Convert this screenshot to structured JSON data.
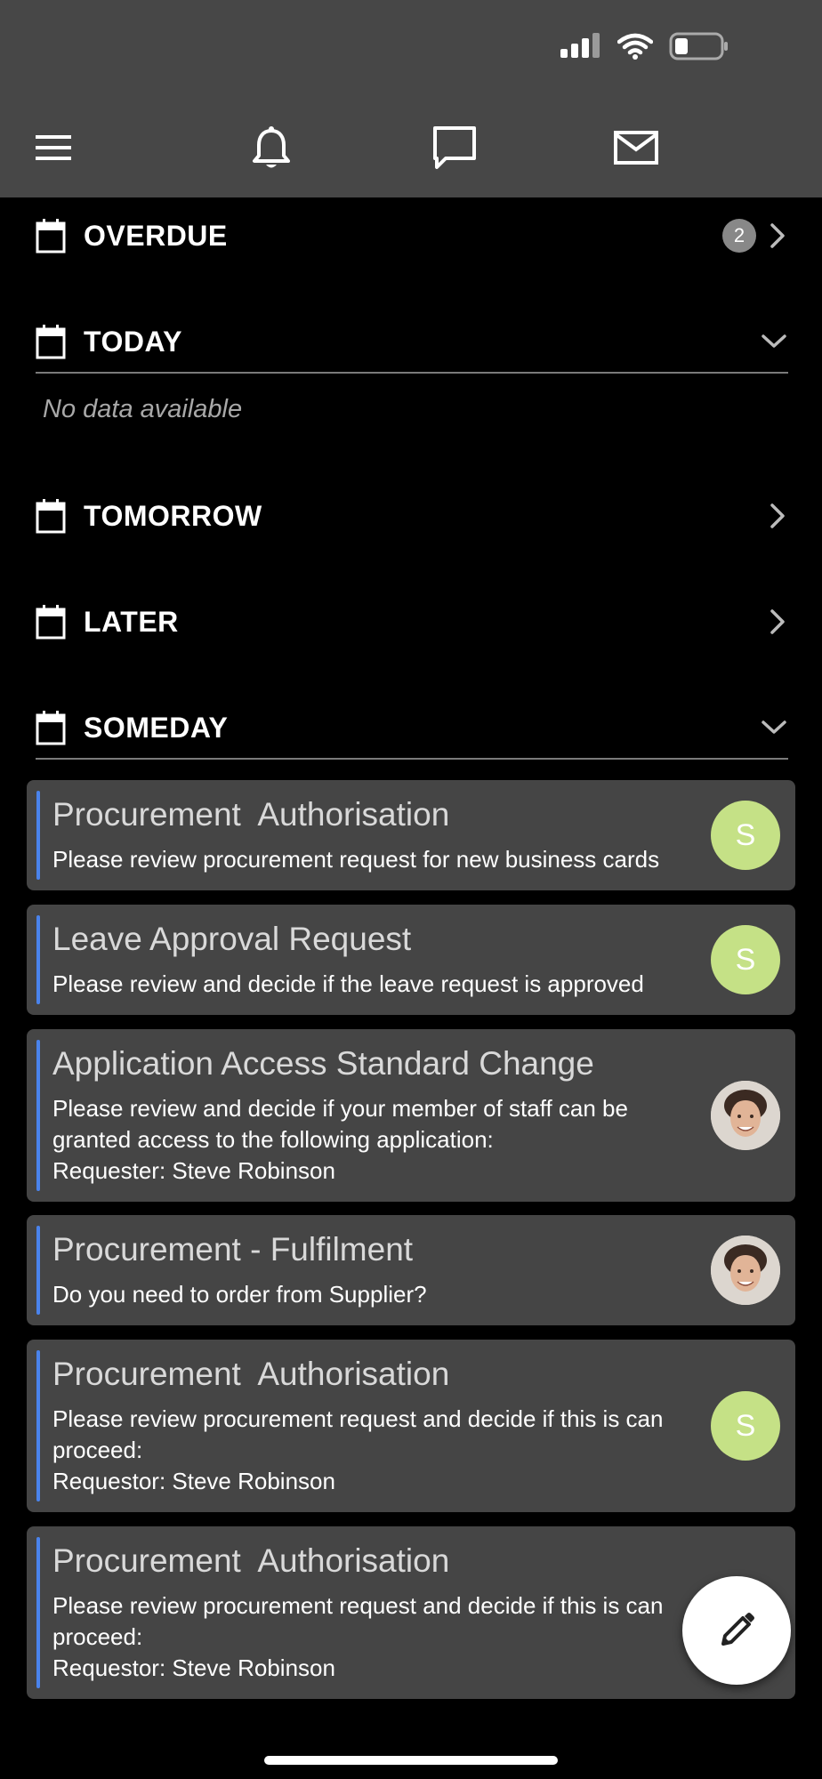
{
  "nav": {
    "icons": [
      "menu-icon",
      "bell-icon",
      "chat-icon",
      "mail-icon"
    ]
  },
  "sections": {
    "overdue": {
      "label": "OVERDUE",
      "count": "2"
    },
    "today": {
      "label": "TODAY",
      "empty_text": "No data available"
    },
    "tomorrow": {
      "label": "TOMORROW"
    },
    "later": {
      "label": "LATER"
    },
    "someday": {
      "label": "SOMEDAY"
    }
  },
  "tasks": [
    {
      "title": "Procurement  Authorisation",
      "description": "Please review procurement request for new business cards",
      "avatar_letter": "S"
    },
    {
      "title": "Leave Approval Request",
      "description": "Please review and decide if the leave request is approved",
      "avatar_letter": "S"
    },
    {
      "title": "Application Access Standard Change",
      "description": "Please review and decide if your member of staff can be granted access to the following application:\nRequester: Steve Robinson",
      "avatar_type": "photo"
    },
    {
      "title": "Procurement - Fulfilment",
      "description": "Do you need to order from Supplier?",
      "avatar_type": "photo"
    },
    {
      "title": "Procurement  Authorisation",
      "description": "Please review procurement request and decide if this is can proceed:\nRequestor: Steve Robinson",
      "avatar_letter": "S"
    },
    {
      "title": "Procurement  Authorisation",
      "description": "Please review procurement request and decide if this is can proceed:\nRequestor: Steve Robinson"
    }
  ],
  "colors": {
    "header_bg": "#474747",
    "card_bg": "#454545",
    "card_accent": "#4a83ec",
    "avatar_green": "#c5e186"
  }
}
